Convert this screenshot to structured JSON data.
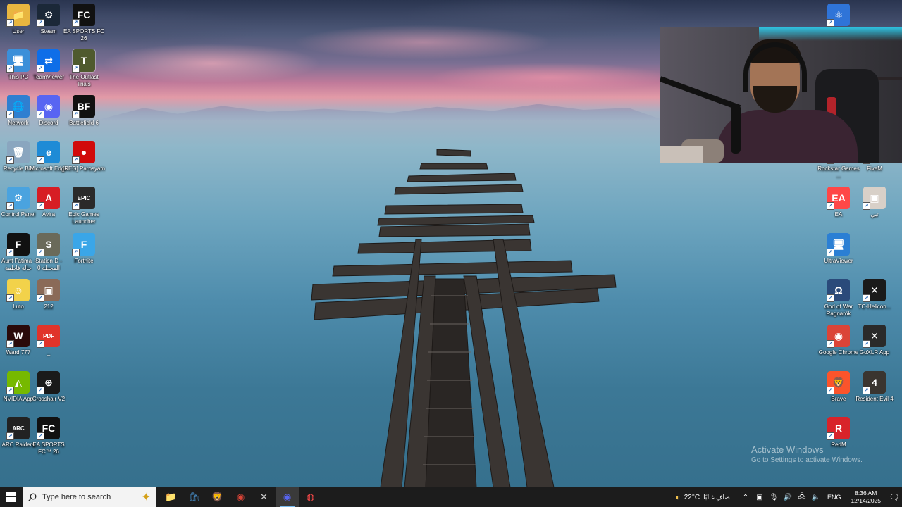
{
  "desktop_icons": [
    {
      "label": "User",
      "icon": "user-folder-icon",
      "color": "#e8b640",
      "glyph": "📁"
    },
    {
      "label": "Steam",
      "icon": "steam-icon",
      "color": "#1b2838",
      "glyph": "⚙"
    },
    {
      "label": "EA SPORTS FC 26",
      "icon": "ea-fc26-icon",
      "color": "#111111",
      "glyph": "FC"
    },
    {
      "label": "This PC",
      "icon": "this-pc-icon",
      "color": "#3b8fd9",
      "glyph": "🖥"
    },
    {
      "label": "TeamViewer",
      "icon": "teamviewer-icon",
      "color": "#0e6ee8",
      "glyph": "⇄"
    },
    {
      "label": "The Outlast Trials",
      "icon": "outlast-trials-icon",
      "color": "#4f5a2e",
      "glyph": "T"
    },
    {
      "label": "Network",
      "icon": "network-icon",
      "color": "#2f7fd1",
      "glyph": "🌐"
    },
    {
      "label": "Discord",
      "icon": "discord-icon",
      "color": "#5865f2",
      "glyph": "◉"
    },
    {
      "label": "Battlefield 6",
      "icon": "battlefield-icon",
      "color": "#111111",
      "glyph": "BF"
    },
    {
      "label": "Recycle Bin",
      "icon": "recycle-bin-icon",
      "color": "#8aa6bf",
      "glyph": "🗑"
    },
    {
      "label": "Microsoft Edge",
      "icon": "edge-icon",
      "color": "#1e8bd6",
      "glyph": "e"
    },
    {
      "label": "[REG] Parosyam",
      "icon": "reg-record-icon",
      "color": "#d10a0a",
      "glyph": "●"
    },
    {
      "label": "Control Panel",
      "icon": "control-panel-icon",
      "color": "#4aa3df",
      "glyph": "⚙"
    },
    {
      "label": "Avira",
      "icon": "avira-icon",
      "color": "#d71d24",
      "glyph": "A"
    },
    {
      "label": "Epic Games Launcher",
      "icon": "epic-games-icon",
      "color": "#2a2a2a",
      "glyph": "EPIC"
    },
    {
      "label": "Aunt Fatima - خالة فاطمة",
      "icon": "aunt-fatima-icon",
      "color": "#111111",
      "glyph": "F"
    },
    {
      "label": "Station D - المحطة 0",
      "icon": "station-d-icon",
      "color": "#6a6a5a",
      "glyph": "S"
    },
    {
      "label": "Fortnite",
      "icon": "fortnite-icon",
      "color": "#3aa6e8",
      "glyph": "F"
    },
    {
      "label": "Luto",
      "icon": "luto-icon",
      "color": "#f2d24a",
      "glyph": "☺"
    },
    {
      "label": "212",
      "icon": "212-icon",
      "color": "#8a6a58",
      "glyph": "▣"
    },
    {
      "label": "Ward 777",
      "icon": "ward-777-icon",
      "color": "#2a0a0a",
      "glyph": "W"
    },
    {
      "label": "_",
      "icon": "pdf-file-icon",
      "color": "#e0342a",
      "glyph": "PDF"
    },
    {
      "label": "NVIDIA App",
      "icon": "nvidia-icon",
      "color": "#76b900",
      "glyph": "◭"
    },
    {
      "label": "Crosshair V2",
      "icon": "crosshair-icon",
      "color": "#1a1a1a",
      "glyph": "⊕"
    },
    {
      "label": "ARC Raiders",
      "icon": "arc-raiders-icon",
      "color": "#222222",
      "glyph": "ARC"
    },
    {
      "label": "EA SPORTS FC™ 26",
      "icon": "ea-fc26-alt-icon",
      "color": "#111111",
      "glyph": "FC"
    },
    {
      "label": "Rockstar Games ...",
      "icon": "rockstar-icon",
      "color": "#f0b400",
      "glyph": "R"
    },
    {
      "label": "FiveM",
      "icon": "fivem-icon",
      "color": "#f36f21",
      "glyph": "5"
    },
    {
      "label": "EA",
      "icon": "ea-icon",
      "color": "#ff4747",
      "glyph": "EA"
    },
    {
      "label": "تبي",
      "icon": "tabi-icon",
      "color": "#d8d0c8",
      "glyph": "▣"
    },
    {
      "label": "UltraViewer",
      "icon": "ultraviewer-icon",
      "color": "#2b7fd4",
      "glyph": "🖥"
    },
    {
      "label": "God of War Ragnarök",
      "icon": "god-of-war-icon",
      "color": "#2a4a7a",
      "glyph": "Ω"
    },
    {
      "label": "TC-Helicon...",
      "icon": "tc-helicon-icon",
      "color": "#1a1a1a",
      "glyph": "✕"
    },
    {
      "label": "Google Chrome",
      "icon": "chrome-icon",
      "color": "#db4437",
      "glyph": "◉"
    },
    {
      "label": "GoXLR App",
      "icon": "goxlr-icon",
      "color": "#2a2a2a",
      "glyph": "✕"
    },
    {
      "label": "Brave",
      "icon": "brave-icon",
      "color": "#fb542b",
      "glyph": "🦁"
    },
    {
      "label": "Resident Evil 4",
      "icon": "resident-evil-icon",
      "color": "#3a3530",
      "glyph": "4"
    },
    {
      "label": "RedM",
      "icon": "redm-icon",
      "color": "#d8232a",
      "glyph": "R"
    },
    {
      "label": "",
      "icon": "atom-app-icon",
      "color": "#2f74d8",
      "glyph": "⚛"
    }
  ],
  "activation": {
    "title": "Activate Windows",
    "subtitle": "Go to Settings to activate Windows."
  },
  "taskbar": {
    "search_placeholder": "Type here to search",
    "apps": [
      {
        "name": "file-explorer-icon",
        "glyph": "📁",
        "color": "#f2c94c"
      },
      {
        "name": "microsoft-store-icon",
        "glyph": "🛍",
        "color": "#4fa3e8"
      },
      {
        "name": "brave-taskbar-icon",
        "glyph": "🦁",
        "color": "#fb542b"
      },
      {
        "name": "chrome-taskbar-icon",
        "glyph": "◉",
        "color": "#db4437"
      },
      {
        "name": "goxlr-taskbar-icon",
        "glyph": "✕",
        "color": "#cccccc"
      },
      {
        "name": "discord-taskbar-icon",
        "glyph": "◉",
        "color": "#5865f2"
      },
      {
        "name": "obs-taskbar-icon",
        "glyph": "◍",
        "color": "#ff4a4a"
      }
    ],
    "weather_temp": "22°C",
    "weather_text": "صافٍ غالبًا",
    "language": "ENG",
    "time": "8:36 AM",
    "date": "12/14/2025"
  }
}
